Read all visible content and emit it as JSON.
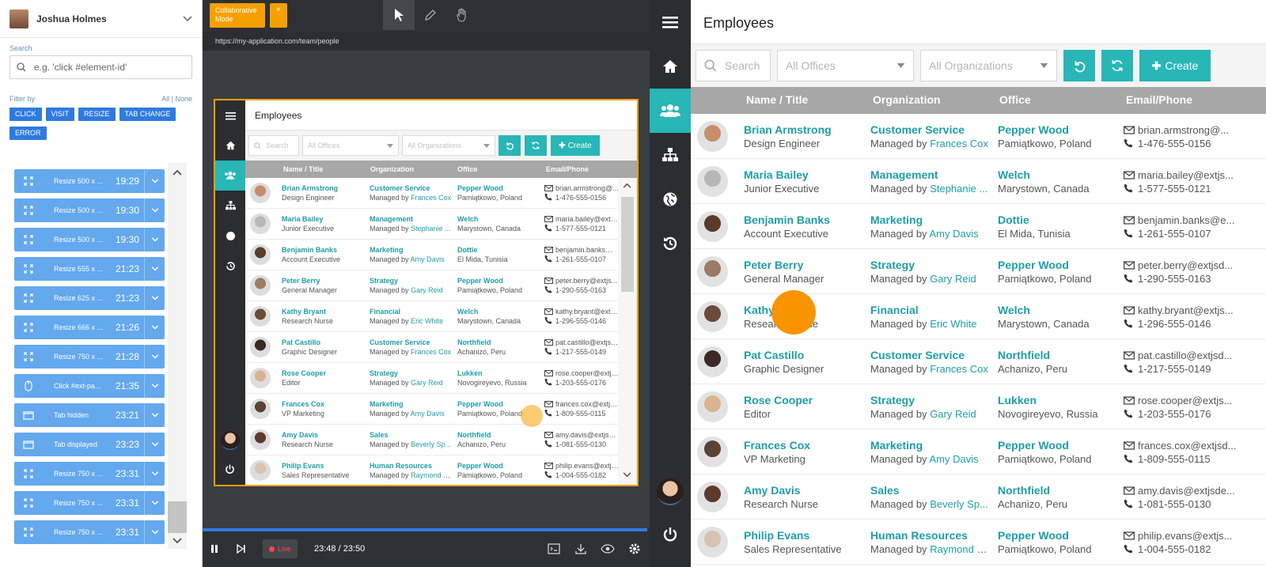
{
  "left": {
    "user_name": "Joshua Holmes",
    "search_label": "Search",
    "search_placeholder": "e.g. 'click #element-id'",
    "filter_label": "Filter by",
    "filter_all": "All",
    "filter_sep": "|",
    "filter_none": "None",
    "chips": [
      "CLICK",
      "VISIT",
      "RESIZE",
      "TAB CHANGE",
      "ERROR"
    ],
    "events": [
      {
        "icon": "resize-icon",
        "text": "Resize 500 x ...",
        "time": "19:29"
      },
      {
        "icon": "resize-icon",
        "text": "Resize 500 x ...",
        "time": "19:30"
      },
      {
        "icon": "resize-icon",
        "text": "Resize 500 x ...",
        "time": "19:30"
      },
      {
        "icon": "resize-icon",
        "text": "Resize 555 x ...",
        "time": "21:23"
      },
      {
        "icon": "resize-icon",
        "text": "Resize 625 x ...",
        "time": "21:23"
      },
      {
        "icon": "resize-icon",
        "text": "Resize 666 x ...",
        "time": "21:26"
      },
      {
        "icon": "resize-icon",
        "text": "Resize 750 x ...",
        "time": "21:28"
      },
      {
        "icon": "mouse-icon",
        "text": "Click #ext-pa...",
        "time": "21:35"
      },
      {
        "icon": "tab-icon",
        "text": "Tab hidden",
        "time": "23:21"
      },
      {
        "icon": "tab-icon",
        "text": "Tab displayed",
        "time": "23:23"
      },
      {
        "icon": "resize-icon",
        "text": "Resize 750 x ...",
        "time": "23:31"
      },
      {
        "icon": "resize-icon",
        "text": "Resize 750 x ...",
        "time": "23:31"
      },
      {
        "icon": "resize-icon",
        "text": "Resize 750 x ...",
        "time": "23:31"
      }
    ]
  },
  "player": {
    "collab_label": "Collaborative Mode",
    "close_label": "×",
    "url": "https://my-application.com/team/people",
    "live_label": "Live",
    "time": "23:48 / 23:50"
  },
  "app": {
    "title": "Employees",
    "search_placeholder": "Search",
    "offices_placeholder": "All Offices",
    "orgs_placeholder": "All Organizations",
    "create_label": "Create",
    "columns": [
      "Name / Title",
      "Organization",
      "Office",
      "Email/Phone"
    ],
    "managed_prefix": "Managed by",
    "employees": [
      {
        "name": "Brian Armstrong",
        "title": "Design Engineer",
        "org": "Customer Service",
        "manager": "Frances Cox",
        "office": "Pepper Wood",
        "location": "Pamiątkowo, Poland",
        "email": "brian.armstrong@...",
        "phone": "1-476-555-0156",
        "small_email": "brian.armstrong@...",
        "small_manager": "Frances Cox"
      },
      {
        "name": "Maria Bailey",
        "title": "Junior Executive",
        "org": "Management",
        "manager": "Stephanie ...",
        "office": "Welch",
        "location": "Marystown, Canada",
        "email": "maria.bailey@extjs...",
        "phone": "1-577-555-0121",
        "small_email": "maria.bailey@extjs...",
        "small_manager": "Stephanie ..."
      },
      {
        "name": "Benjamin Banks",
        "title": "Account Executive",
        "org": "Marketing",
        "manager": "Amy Davis",
        "office": "Dottie",
        "location": "El Mida, Tunisia",
        "email": "benjamin.banks@e...",
        "phone": "1-261-555-0107",
        "small_email": "benjamin.banks@e...",
        "small_manager": "Amy Davis"
      },
      {
        "name": "Peter Berry",
        "title": "General Manager",
        "org": "Strategy",
        "manager": "Gary Reid",
        "office": "Pepper Wood",
        "location": "Pamiątkowo, Poland",
        "email": "peter.berry@extjsd...",
        "phone": "1-290-555-0163",
        "small_email": "peter.berry@extjs...",
        "small_manager": "Gary Reid"
      },
      {
        "name": "Kathy Bryant",
        "title": "Research Nurse",
        "org": "Financial",
        "manager": "Eric White",
        "office": "Welch",
        "location": "Marystown, Canada",
        "email": "kathy.bryant@extjs...",
        "phone": "1-296-555-0146",
        "small_email": "kathy.bryant@extjs...",
        "small_manager": "Eric White"
      },
      {
        "name": "Pat Castillo",
        "title": "Graphic Designer",
        "org": "Customer Service",
        "manager": "Frances Cox",
        "office": "Northfield",
        "location": "Achanizo, Peru",
        "email": "pat.castillo@extjsd...",
        "phone": "1-217-555-0149",
        "small_email": "pat.castillo@extjsd...",
        "small_manager": "Frances Cox"
      },
      {
        "name": "Rose Cooper",
        "title": "Editor",
        "org": "Strategy",
        "manager": "Gary Reid",
        "office": "Lukken",
        "location": "Novogireyevo, Russia",
        "email": "rose.cooper@extjs...",
        "phone": "1-203-555-0176",
        "small_email": "rose.cooper@extjs...",
        "small_manager": "Gary Reid"
      },
      {
        "name": "Frances Cox",
        "title": "VP Marketing",
        "org": "Marketing",
        "manager": "Amy Davis",
        "office": "Pepper Wood",
        "location": "Pamiątkowo, Poland",
        "email": "frances.cox@extjsd...",
        "phone": "1-809-555-0115",
        "small_email": "frances.cox@extjsd...",
        "small_manager": "Amy Davis"
      },
      {
        "name": "Amy Davis",
        "title": "Research Nurse",
        "org": "Sales",
        "manager": "Beverly Sp...",
        "office": "Northfield",
        "location": "Achanizo, Peru",
        "email": "amy.davis@extjsde...",
        "phone": "1-081-555-0130",
        "small_email": "amy.davis@extjsde...",
        "small_manager": "Beverly Sp..."
      },
      {
        "name": "Philip Evans",
        "title": "Sales Representative",
        "org": "Human Resources",
        "manager": "Raymond K...",
        "office": "Pepper Wood",
        "location": "Pamiątkowo, Poland",
        "email": "philip.evans@extjs...",
        "phone": "1-004-555-0182",
        "small_email": "philip.evans@extjs...",
        "small_manager": "Raymond K..."
      }
    ]
  },
  "colors": {
    "teal": "#28b6b6",
    "orange": "#f6a000",
    "blue_event": "#64a8ee",
    "chip_blue": "#2f7ae0"
  }
}
